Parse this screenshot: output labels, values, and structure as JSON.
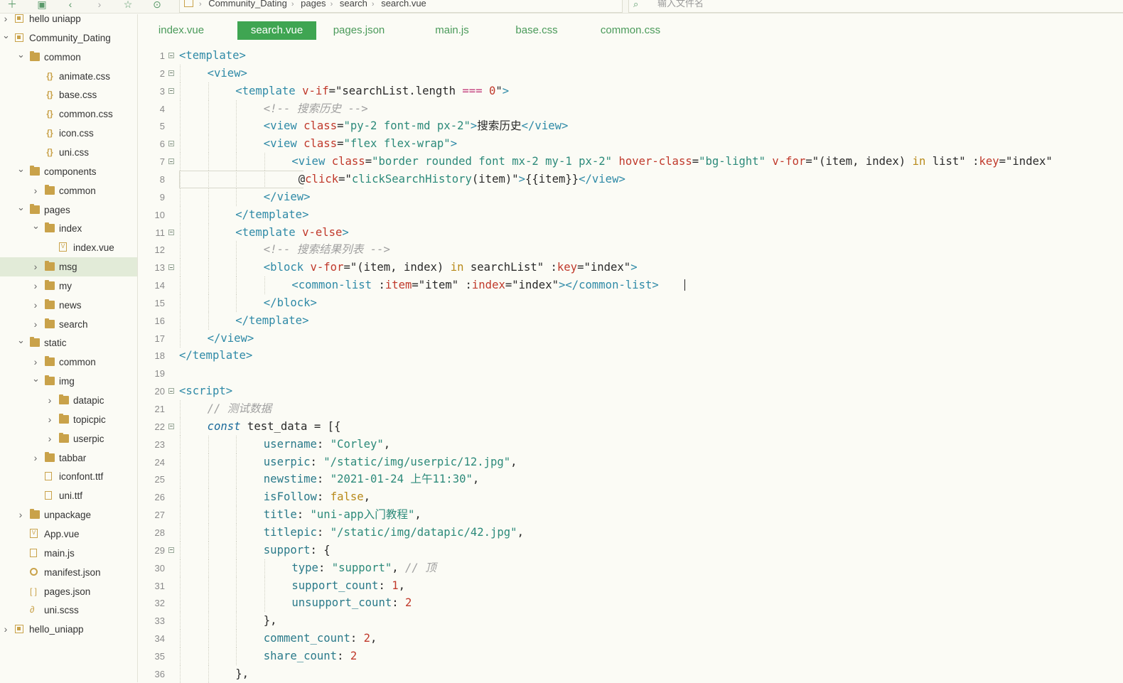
{
  "toolbar": {
    "icons": [
      "new-file-icon",
      "save-icon",
      "back-icon",
      "forward-icon",
      "star-icon",
      "run-icon"
    ]
  },
  "breadcrumb": [
    "Community_Dating",
    "pages",
    "search",
    "search.vue"
  ],
  "file_search": {
    "placeholder": "输入文件名"
  },
  "tree": [
    {
      "label": "hello uniapp",
      "level": 0,
      "type": "project",
      "chev": "›"
    },
    {
      "label": "Community_Dating",
      "level": 0,
      "type": "project",
      "chev": "⌄"
    },
    {
      "label": "common",
      "level": 1,
      "type": "folder",
      "chev": "⌄"
    },
    {
      "label": "animate.css",
      "level": 2,
      "type": "css"
    },
    {
      "label": "base.css",
      "level": 2,
      "type": "css"
    },
    {
      "label": "common.css",
      "level": 2,
      "type": "css"
    },
    {
      "label": "icon.css",
      "level": 2,
      "type": "css"
    },
    {
      "label": "uni.css",
      "level": 2,
      "type": "css"
    },
    {
      "label": "components",
      "level": 1,
      "type": "folder",
      "chev": "⌄"
    },
    {
      "label": "common",
      "level": 2,
      "type": "folder",
      "chev": "›"
    },
    {
      "label": "pages",
      "level": 1,
      "type": "folder",
      "chev": "⌄"
    },
    {
      "label": "index",
      "level": 2,
      "type": "folder",
      "chev": "⌄"
    },
    {
      "label": "index.vue",
      "level": 3,
      "type": "vue"
    },
    {
      "label": "msg",
      "level": 2,
      "type": "folder",
      "chev": "›",
      "selected": true
    },
    {
      "label": "my",
      "level": 2,
      "type": "folder",
      "chev": "›"
    },
    {
      "label": "news",
      "level": 2,
      "type": "folder",
      "chev": "›"
    },
    {
      "label": "search",
      "level": 2,
      "type": "folder",
      "chev": "›"
    },
    {
      "label": "static",
      "level": 1,
      "type": "folder",
      "chev": "⌄"
    },
    {
      "label": "common",
      "level": 2,
      "type": "folder",
      "chev": "›"
    },
    {
      "label": "img",
      "level": 2,
      "type": "folder",
      "chev": "⌄"
    },
    {
      "label": "datapic",
      "level": 3,
      "type": "folder",
      "chev": "›"
    },
    {
      "label": "topicpic",
      "level": 3,
      "type": "folder",
      "chev": "›"
    },
    {
      "label": "userpic",
      "level": 3,
      "type": "folder",
      "chev": "›"
    },
    {
      "label": "tabbar",
      "level": 2,
      "type": "folder",
      "chev": "›"
    },
    {
      "label": "iconfont.ttf",
      "level": 2,
      "type": "file"
    },
    {
      "label": "uni.ttf",
      "level": 2,
      "type": "file"
    },
    {
      "label": "unpackage",
      "level": 1,
      "type": "folder",
      "chev": "›"
    },
    {
      "label": "App.vue",
      "level": 1,
      "type": "vue"
    },
    {
      "label": "main.js",
      "level": 1,
      "type": "file"
    },
    {
      "label": "manifest.json",
      "level": 1,
      "type": "gear"
    },
    {
      "label": "pages.json",
      "level": 1,
      "type": "brack"
    },
    {
      "label": "uni.scss",
      "level": 1,
      "type": "scss"
    },
    {
      "label": "hello_uniapp",
      "level": 0,
      "type": "project",
      "chev": "›"
    }
  ],
  "tabs": [
    {
      "label": "index.vue",
      "active": false
    },
    {
      "label": "search.vue",
      "active": true
    },
    {
      "label": "pages.json",
      "active": false
    },
    {
      "label": "main.js",
      "active": false
    },
    {
      "label": "base.css",
      "active": false
    },
    {
      "label": "common.css",
      "active": false
    }
  ],
  "code": [
    {
      "n": "1",
      "fold": true,
      "indent": 0,
      "tokens": [
        [
          "t-tag",
          "<template>"
        ]
      ]
    },
    {
      "n": "2",
      "fold": true,
      "indent": 1,
      "tokens": [
        [
          "t-tag",
          "<view>"
        ]
      ]
    },
    {
      "n": "3",
      "fold": true,
      "indent": 2,
      "tokens": [
        [
          "t-tag",
          "<template "
        ],
        [
          "t-attr",
          "v-if"
        ],
        [
          "t-plain",
          "=\""
        ],
        [
          "t-plain",
          "searchList.length "
        ],
        [
          "t-op",
          "==="
        ],
        [
          "t-plain",
          " "
        ],
        [
          "t-num",
          "0"
        ],
        [
          "t-plain",
          "\""
        ],
        [
          "t-tag",
          ">"
        ]
      ]
    },
    {
      "n": "4",
      "fold": false,
      "indent": 3,
      "tokens": [
        [
          "t-cmt",
          "<!-- 搜索历史 -->"
        ]
      ]
    },
    {
      "n": "5",
      "fold": false,
      "indent": 3,
      "tokens": [
        [
          "t-tag",
          "<view "
        ],
        [
          "t-attr",
          "class"
        ],
        [
          "t-plain",
          "="
        ],
        [
          "t-str",
          "\"py-2 font-md px-2\""
        ],
        [
          "t-tag",
          ">"
        ],
        [
          "t-plain",
          "搜索历史"
        ],
        [
          "t-tag",
          "</view>"
        ]
      ]
    },
    {
      "n": "6",
      "fold": true,
      "indent": 3,
      "tokens": [
        [
          "t-tag",
          "<view "
        ],
        [
          "t-attr",
          "class"
        ],
        [
          "t-plain",
          "="
        ],
        [
          "t-str",
          "\"flex flex-wrap\""
        ],
        [
          "t-tag",
          ">"
        ]
      ]
    },
    {
      "n": "7",
      "fold": true,
      "indent": 4,
      "tokens": [
        [
          "t-tag",
          "<view "
        ],
        [
          "t-attr",
          "class"
        ],
        [
          "t-plain",
          "="
        ],
        [
          "t-str",
          "\"border rounded font mx-2 my-1 px-2\""
        ],
        [
          "t-plain",
          " "
        ],
        [
          "t-attr",
          "hover-class"
        ],
        [
          "t-plain",
          "="
        ],
        [
          "t-str",
          "\"bg-light\""
        ],
        [
          "t-plain",
          " "
        ],
        [
          "t-attr",
          "v-for"
        ],
        [
          "t-plain",
          "=\"(item, index) "
        ],
        [
          "t-in",
          "in"
        ],
        [
          "t-plain",
          " list\" :"
        ],
        [
          "t-attr",
          "key"
        ],
        [
          "t-plain",
          "=\"index\""
        ]
      ]
    },
    {
      "n": "8",
      "fold": false,
      "indent": 4,
      "tokens": [
        [
          "t-plain",
          " @"
        ],
        [
          "t-attr",
          "click"
        ],
        [
          "t-plain",
          "=\""
        ],
        [
          "t-str",
          "clickSearchHistory"
        ],
        [
          "t-plain",
          "(item)\""
        ],
        [
          "t-tag",
          ">"
        ],
        [
          "t-plain",
          "{{item}}"
        ],
        [
          "t-tag",
          "</view>"
        ]
      ],
      "current": true
    },
    {
      "n": "9",
      "fold": false,
      "indent": 3,
      "tokens": [
        [
          "t-tag",
          "</view>"
        ]
      ]
    },
    {
      "n": "10",
      "fold": false,
      "indent": 2,
      "tokens": [
        [
          "t-tag",
          "</template>"
        ]
      ]
    },
    {
      "n": "11",
      "fold": true,
      "indent": 2,
      "tokens": [
        [
          "t-tag",
          "<template "
        ],
        [
          "t-attr",
          "v-else"
        ],
        [
          "t-tag",
          ">"
        ]
      ]
    },
    {
      "n": "12",
      "fold": false,
      "indent": 3,
      "tokens": [
        [
          "t-cmt",
          "<!-- 搜索结果列表 -->"
        ]
      ]
    },
    {
      "n": "13",
      "fold": true,
      "indent": 3,
      "tokens": [
        [
          "t-tag",
          "<block "
        ],
        [
          "t-attr",
          "v-for"
        ],
        [
          "t-plain",
          "=\"(item, index) "
        ],
        [
          "t-in",
          "in"
        ],
        [
          "t-plain",
          " searchList\" :"
        ],
        [
          "t-attr",
          "key"
        ],
        [
          "t-plain",
          "=\"index\""
        ],
        [
          "t-tag",
          ">"
        ]
      ]
    },
    {
      "n": "14",
      "fold": false,
      "indent": 4,
      "tokens": [
        [
          "t-tag",
          "<common-list "
        ],
        [
          "t-plain",
          ":"
        ],
        [
          "t-attr",
          "item"
        ],
        [
          "t-plain",
          "=\"item\" :"
        ],
        [
          "t-attr",
          "index"
        ],
        [
          "t-plain",
          "=\"index\""
        ],
        [
          "t-tag",
          "></common-list>"
        ]
      ]
    },
    {
      "n": "15",
      "fold": false,
      "indent": 3,
      "tokens": [
        [
          "t-tag",
          "</block>"
        ]
      ]
    },
    {
      "n": "16",
      "fold": false,
      "indent": 2,
      "tokens": [
        [
          "t-tag",
          "</template>"
        ]
      ]
    },
    {
      "n": "17",
      "fold": false,
      "indent": 1,
      "tokens": [
        [
          "t-tag",
          "</view>"
        ]
      ]
    },
    {
      "n": "18",
      "fold": false,
      "indent": 0,
      "tokens": [
        [
          "t-tag",
          "</template>"
        ]
      ]
    },
    {
      "n": "19",
      "fold": false,
      "indent": 0,
      "tokens": []
    },
    {
      "n": "20",
      "fold": true,
      "indent": 0,
      "tokens": [
        [
          "t-tag",
          "<script>"
        ]
      ]
    },
    {
      "n": "21",
      "fold": false,
      "indent": 1,
      "tokens": [
        [
          "t-cmt",
          "// 测试数据"
        ]
      ]
    },
    {
      "n": "22",
      "fold": true,
      "indent": 1,
      "tokens": [
        [
          "t-kw",
          "const"
        ],
        [
          "t-plain",
          " test_data = [{"
        ]
      ]
    },
    {
      "n": "23",
      "fold": false,
      "indent": 3,
      "tokens": [
        [
          "t-prop",
          "username"
        ],
        [
          "t-plain",
          ": "
        ],
        [
          "t-str",
          "\"Corley\""
        ],
        [
          "t-plain",
          ","
        ]
      ]
    },
    {
      "n": "24",
      "fold": false,
      "indent": 3,
      "tokens": [
        [
          "t-prop",
          "userpic"
        ],
        [
          "t-plain",
          ": "
        ],
        [
          "t-str",
          "\"/static/img/userpic/12.jpg\""
        ],
        [
          "t-plain",
          ","
        ]
      ]
    },
    {
      "n": "25",
      "fold": false,
      "indent": 3,
      "tokens": [
        [
          "t-prop",
          "newstime"
        ],
        [
          "t-plain",
          ": "
        ],
        [
          "t-str",
          "\"2021-01-24 上午11:30\""
        ],
        [
          "t-plain",
          ","
        ]
      ]
    },
    {
      "n": "26",
      "fold": false,
      "indent": 3,
      "tokens": [
        [
          "t-prop",
          "isFollow"
        ],
        [
          "t-plain",
          ": "
        ],
        [
          "t-bool",
          "false"
        ],
        [
          "t-plain",
          ","
        ]
      ]
    },
    {
      "n": "27",
      "fold": false,
      "indent": 3,
      "tokens": [
        [
          "t-prop",
          "title"
        ],
        [
          "t-plain",
          ": "
        ],
        [
          "t-str",
          "\"uni-app入门教程\""
        ],
        [
          "t-plain",
          ","
        ]
      ]
    },
    {
      "n": "28",
      "fold": false,
      "indent": 3,
      "tokens": [
        [
          "t-prop",
          "titlepic"
        ],
        [
          "t-plain",
          ": "
        ],
        [
          "t-str",
          "\"/static/img/datapic/42.jpg\""
        ],
        [
          "t-plain",
          ","
        ]
      ]
    },
    {
      "n": "29",
      "fold": true,
      "indent": 3,
      "tokens": [
        [
          "t-prop",
          "support"
        ],
        [
          "t-plain",
          ": {"
        ]
      ]
    },
    {
      "n": "30",
      "fold": false,
      "indent": 4,
      "tokens": [
        [
          "t-prop",
          "type"
        ],
        [
          "t-plain",
          ": "
        ],
        [
          "t-str",
          "\"support\""
        ],
        [
          "t-plain",
          ", "
        ],
        [
          "t-cmt",
          "// 顶"
        ]
      ]
    },
    {
      "n": "31",
      "fold": false,
      "indent": 4,
      "tokens": [
        [
          "t-prop",
          "support_count"
        ],
        [
          "t-plain",
          ": "
        ],
        [
          "t-num",
          "1"
        ],
        [
          "t-plain",
          ","
        ]
      ]
    },
    {
      "n": "32",
      "fold": false,
      "indent": 4,
      "tokens": [
        [
          "t-prop",
          "unsupport_count"
        ],
        [
          "t-plain",
          ": "
        ],
        [
          "t-num",
          "2"
        ]
      ]
    },
    {
      "n": "33",
      "fold": false,
      "indent": 3,
      "tokens": [
        [
          "t-plain",
          "},"
        ]
      ]
    },
    {
      "n": "34",
      "fold": false,
      "indent": 3,
      "tokens": [
        [
          "t-prop",
          "comment_count"
        ],
        [
          "t-plain",
          ": "
        ],
        [
          "t-num",
          "2"
        ],
        [
          "t-plain",
          ","
        ]
      ]
    },
    {
      "n": "35",
      "fold": false,
      "indent": 3,
      "tokens": [
        [
          "t-prop",
          "share_count"
        ],
        [
          "t-plain",
          ": "
        ],
        [
          "t-num",
          "2"
        ]
      ]
    },
    {
      "n": "36",
      "fold": false,
      "indent": 2,
      "tokens": [
        [
          "t-plain",
          "},"
        ]
      ]
    }
  ]
}
